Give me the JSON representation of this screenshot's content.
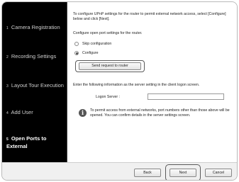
{
  "sidebar": {
    "steps": [
      {
        "number": "1",
        "label": "Camera Registration"
      },
      {
        "number": "2",
        "label": "Recording Settings"
      },
      {
        "number": "3",
        "label": "Layout Tour Execution"
      },
      {
        "number": "4",
        "label": "Add User"
      },
      {
        "number": "5",
        "label": "Open Ports to External"
      }
    ]
  },
  "main": {
    "intro": "To configure UPnP settings for the router to permit external network access, select [Configure] below and click [Next].",
    "open_ports_label": "Configure open port settings for the router.",
    "options": [
      "Skip configuration",
      "Configure"
    ],
    "selected_option": "Configure",
    "send_button": "Send request to router",
    "enter_info": "Enter the following information as the server setting in the client logon screen.",
    "logon_server_label": "Logon Server :",
    "logon_server_value": "",
    "info_text": "To permit access from external networks, port numbers other than those above will be opened. You can confirm details in the server settings screen."
  },
  "footer": {
    "back": "Back",
    "next": "Next",
    "cancel": "Cancel"
  }
}
